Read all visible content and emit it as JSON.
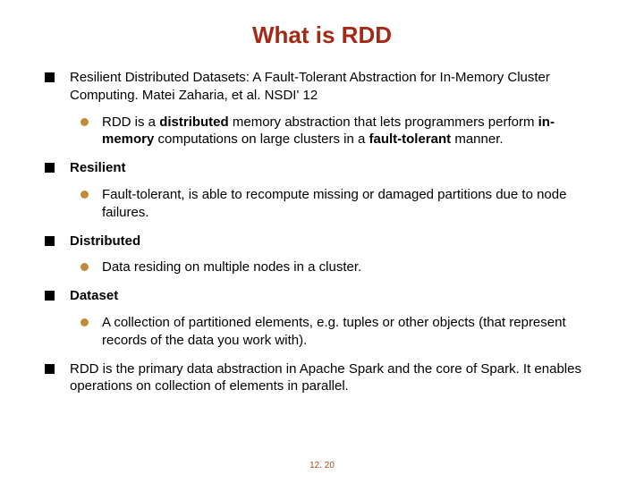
{
  "title": "What is RDD",
  "items": {
    "a": {
      "pre": "Resilient Distributed Datasets: A Fault-Tolerant Abstraction for In-Memory Cluster Computing. Matei Zaharia, et al. NSDI' 12",
      "sub": {
        "s1": "RDD is a ",
        "s2": "distributed",
        "s3": " memory abstraction that lets programmers perform ",
        "s4": "in-memory",
        "s5": " computations on large clusters in a ",
        "s6": "fault-tolerant",
        "s7": " manner."
      }
    },
    "b": {
      "label": "Resilient",
      "sub": "Fault-tolerant, is able to recompute missing or damaged partitions due to node failures."
    },
    "c": {
      "label": "Distributed",
      "sub": "Data residing on multiple nodes in a cluster."
    },
    "d": {
      "label": "Dataset",
      "sub": "A collection of partitioned elements, e.g. tuples or other objects (that represent records of the data you work with)."
    },
    "e": {
      "text": "RDD is the primary data abstraction in Apache Spark and the core of Spark. It enables operations on collection of elements in parallel."
    }
  },
  "footer": "12. 20"
}
